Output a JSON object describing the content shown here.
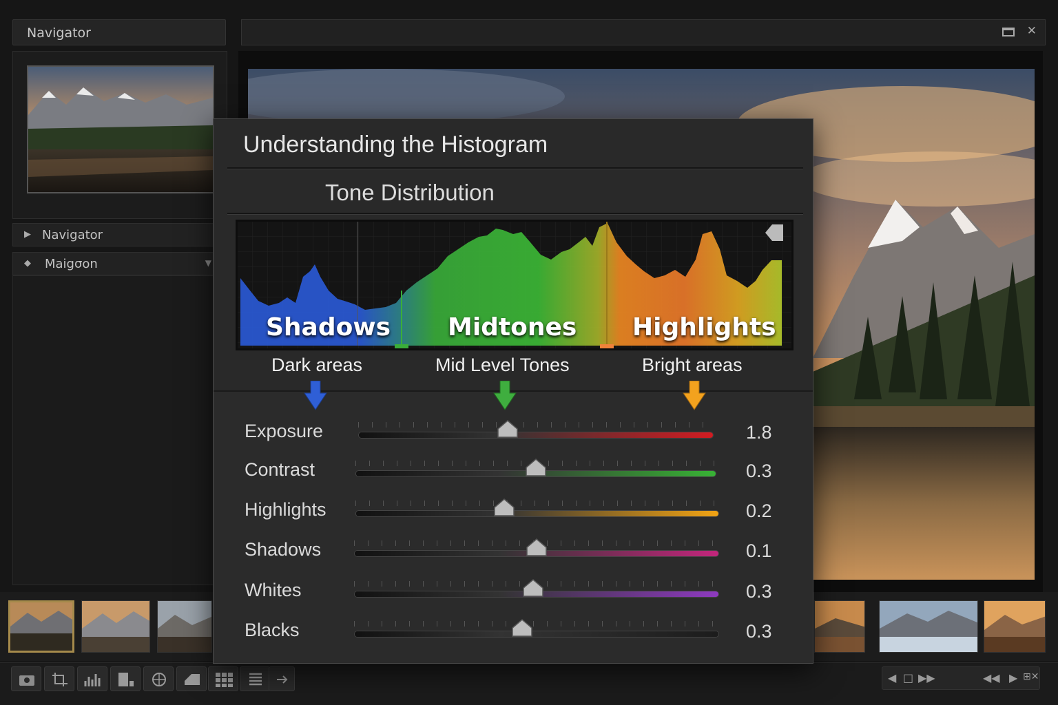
{
  "left_panel": {
    "header_title": "Navigator",
    "rows": [
      {
        "label": "Navigator"
      },
      {
        "label": "Maigσon"
      }
    ]
  },
  "overlay": {
    "title": "Understanding the Histogram",
    "subtitle": "Tone Distribution",
    "zones": [
      {
        "name": "Shadows",
        "description": "Dark areas",
        "color": "#2f5fd6"
      },
      {
        "name": "Midtones",
        "description": "Mid Level Tones",
        "color": "#3fae3f"
      },
      {
        "name": "Highlights",
        "description": "Bright areas",
        "color": "#f3a21e"
      }
    ],
    "sliders": [
      {
        "label": "Exposure",
        "value": "1.8",
        "position": 0.42,
        "accent": "#d21c22"
      },
      {
        "label": "Contrast",
        "value": "0.3",
        "position": 0.5,
        "accent": "#38b235"
      },
      {
        "label": "Highlights",
        "value": "0.2",
        "position": 0.41,
        "accent": "#f2a414"
      },
      {
        "label": "Shadows",
        "value": "0.1",
        "position": 0.5,
        "accent": "#c3267c"
      },
      {
        "label": "Whites",
        "value": "0.3",
        "position": 0.49,
        "accent": "#8e3ac0"
      },
      {
        "label": "Blacks",
        "value": "0.3",
        "position": 0.46,
        "accent": "#1c1c1c"
      }
    ]
  },
  "toolbar": {
    "icons": [
      "camera-icon",
      "crop-icon",
      "histogram-icon",
      "layout-icon",
      "globe-icon",
      "compare-icon",
      "grid-icon",
      "list-icon",
      "arrow-right-icon"
    ],
    "playback": [
      "prev-icon",
      "stop-icon",
      "forward-icon",
      "rewind-icon",
      "play-icon",
      "grid-close-icon"
    ]
  }
}
